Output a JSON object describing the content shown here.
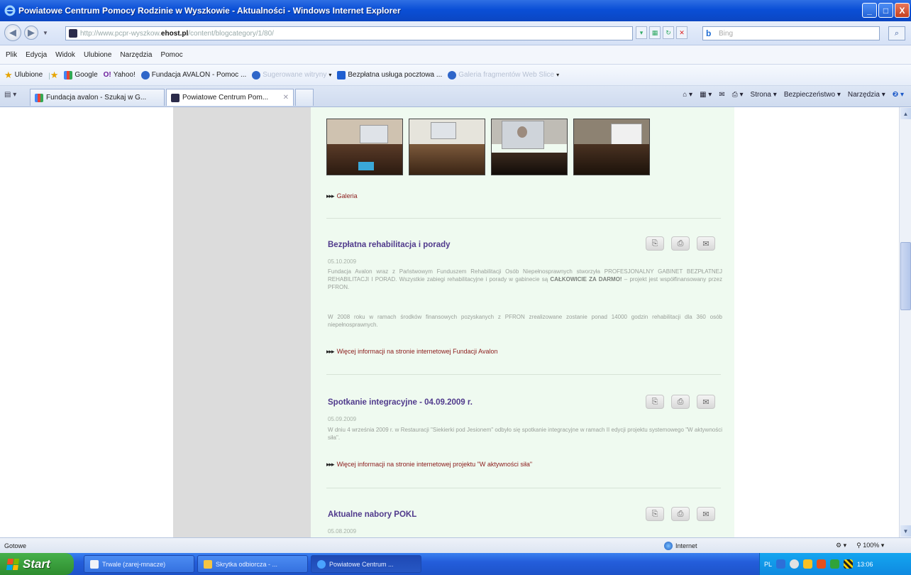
{
  "window": {
    "title": "Powiatowe Centrum Pomocy Rodzinie w Wyszkowie - Aktualności - Windows Internet Explorer",
    "min": "_",
    "max": "□",
    "close": "X"
  },
  "address": {
    "url_prefix": "http://www.pcpr-wyszkow.",
    "url_domain": "ehost.pl",
    "url_suffix": "/content/blogcategory/1/80/",
    "search_placeholder": "Bing",
    "search_brand": "b"
  },
  "menu": [
    "Plik",
    "Edycja",
    "Widok",
    "Ulubione",
    "Narzędzia",
    "Pomoc"
  ],
  "favorites": {
    "label": "Ulubione",
    "items": [
      "Google",
      "Yahoo!",
      "Fundacja AVALON - Pomoc ...",
      "Sugerowane witryny",
      "Bezpłatna usługa pocztowa ...",
      "Galeria fragmentów Web Slice"
    ]
  },
  "tabs": [
    {
      "label": "Fundacja avalon - Szukaj w G..."
    },
    {
      "label": "Powiatowe Centrum Pom..."
    }
  ],
  "commandbar": [
    "Strona",
    "Bezpieczeństwo",
    "Narzędzia"
  ],
  "content": {
    "gallery_link": "Galeria",
    "articles": [
      {
        "title": "Bezpłatna rehabilitacja i porady",
        "date": "05.10.2009",
        "text1": "Fundacja Avalon wraz z Państwowym Funduszem Rehabilitacji Osób Niepełnosprawnych stworzyła PROFESJONALNY GABINET BEZPŁATNEJ REHABILITACJI I PORAD. Wszystkie zabiegi rehabilitacyjne i porady w gabinecie są",
        "text1_bold": "CAŁKOWICIE ZA DARMO!",
        "text1_end": " – projekt jest współfinansowany przez PFRON.",
        "text2": "W 2008 roku w ramach środków finansowych pozyskanych z PFRON zrealizowane zostanie ponad 14000 godzin rehabilitacji dla 360 osób niepełnosprawnych.",
        "link": "Więcej informacji na stronie internetowej Fundacji Avalon"
      },
      {
        "title": "Spotkanie integracyjne - 04.09.2009 r.",
        "date": "05.09.2009",
        "text1": "W dniu 4 września 2009 r. w Restauracji \"Siekierki pod Jesionem\" odbyło się spotkanie integracyjne w ramach II edycji projektu systemowego \"W aktywności siła\".",
        "link": "Więcej informacji na stronie internetowej projektu \"W aktywności siła\""
      },
      {
        "title": "Aktualne nabory POKL",
        "date": "05.08.2009"
      }
    ]
  },
  "status": {
    "left": "Gotowe",
    "zone": "Internet",
    "zoom": "100%"
  },
  "taskbar": {
    "start": "Start",
    "buttons": [
      "Trwale (zarej-mnacze)",
      "Skrytka odbiorcza - ...",
      "Powiatowe Centrum ..."
    ],
    "clock": "13:06",
    "lang": "PL"
  }
}
